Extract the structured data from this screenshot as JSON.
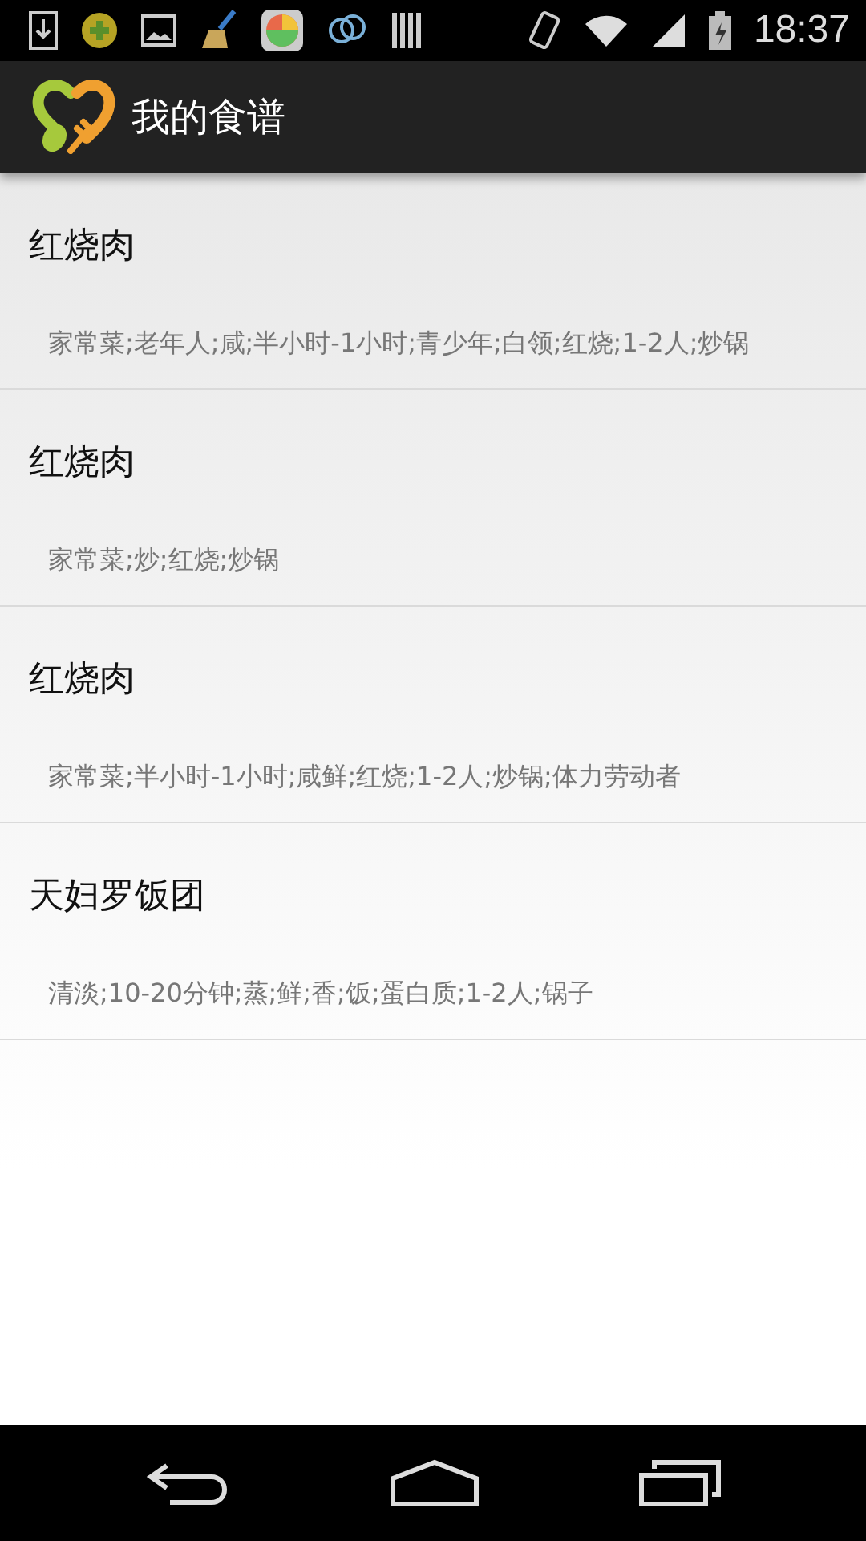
{
  "status_bar": {
    "time": "18:37"
  },
  "action_bar": {
    "title": "我的食谱"
  },
  "recipes": [
    {
      "name": "红烧肉",
      "tags": "家常菜;老年人;咸;半小时-1小时;青少年;白领;红烧;1-2人;炒锅"
    },
    {
      "name": "红烧肉",
      "tags": "家常菜;炒;红烧;炒锅"
    },
    {
      "name": "红烧肉",
      "tags": "家常菜;半小时-1小时;咸鲜;红烧;1-2人;炒锅;体力劳动者"
    },
    {
      "name": "天妇罗饭团",
      "tags": "清淡;10-20分钟;蒸;鲜;香;饭;蛋白质;1-2人;锅子"
    }
  ]
}
